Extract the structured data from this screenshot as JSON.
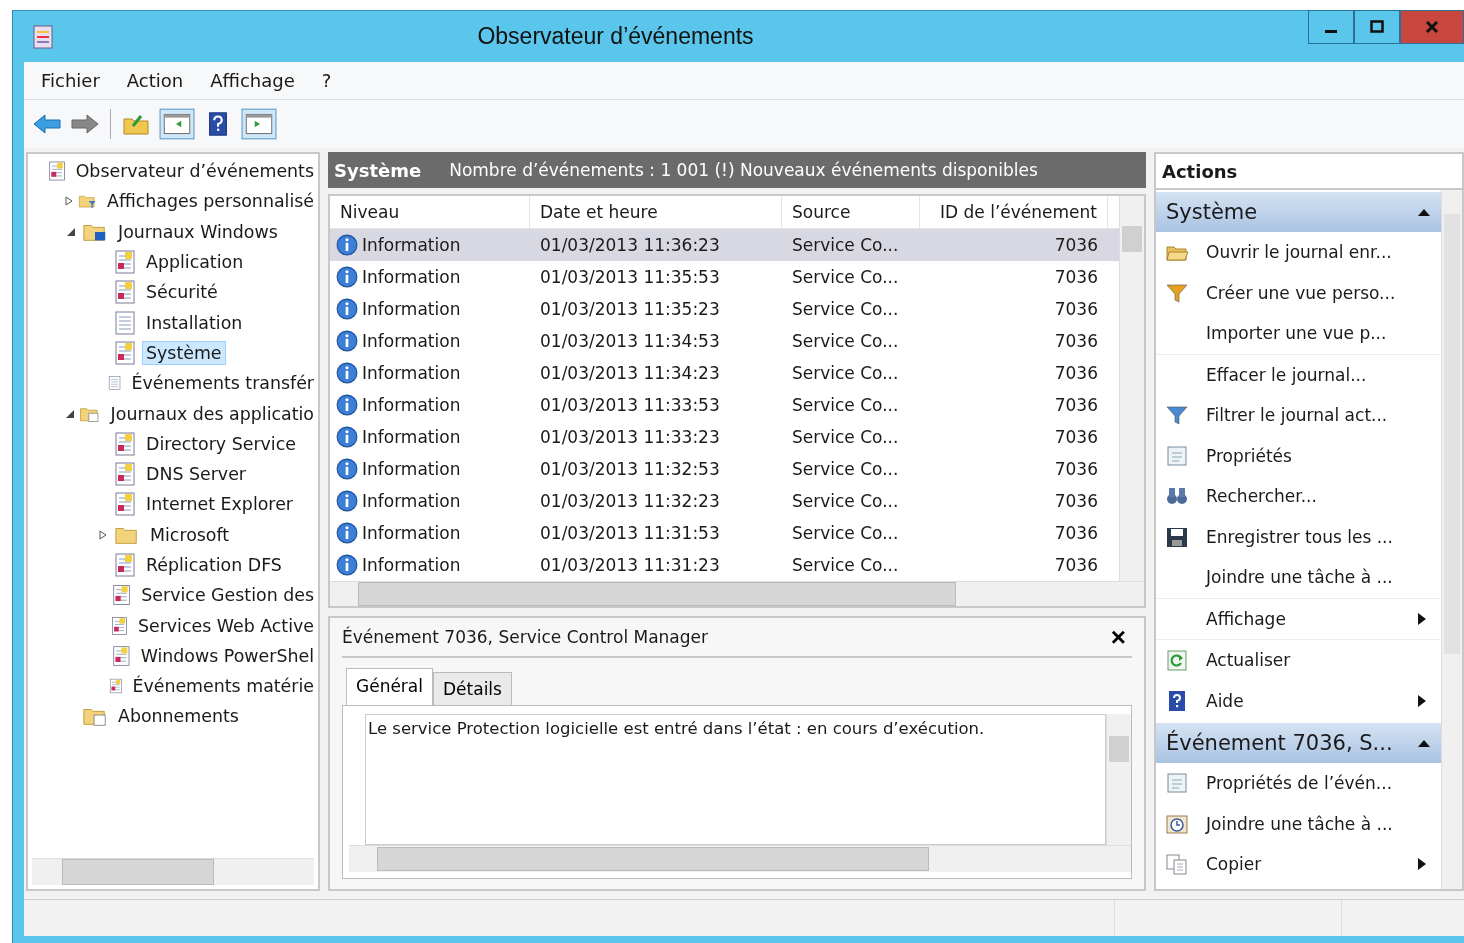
{
  "window": {
    "title": "Observateur d’événements"
  },
  "menu": [
    "Fichier",
    "Action",
    "Affichage",
    "?"
  ],
  "tree": [
    {
      "label": "Observateur d’événements",
      "kind": "root",
      "selected": false,
      "children": [
        {
          "label": "Affichages personnalisé",
          "kind": "custom",
          "expanded": false,
          "selected": false
        },
        {
          "label": "Journaux Windows",
          "kind": "windows",
          "expanded": true,
          "selected": false,
          "children": [
            {
              "label": "Application",
              "kind": "log",
              "selected": false
            },
            {
              "label": "Sécurité",
              "kind": "log",
              "selected": false
            },
            {
              "label": "Installation",
              "kind": "plain",
              "selected": false
            },
            {
              "label": "Système",
              "kind": "log",
              "selected": true
            },
            {
              "label": "Événements transfér",
              "kind": "plain",
              "selected": false
            }
          ]
        },
        {
          "label": "Journaux des applicatio",
          "kind": "apps",
          "expanded": true,
          "selected": false,
          "children": [
            {
              "label": "Directory Service",
              "kind": "log",
              "selected": false
            },
            {
              "label": "DNS Server",
              "kind": "log",
              "selected": false
            },
            {
              "label": "Internet Explorer",
              "kind": "log",
              "selected": false
            },
            {
              "label": "Microsoft",
              "kind": "folder",
              "expanded": false,
              "selected": false
            },
            {
              "label": "Réplication DFS",
              "kind": "log",
              "selected": false
            },
            {
              "label": "Service Gestion des",
              "kind": "log",
              "selected": false
            },
            {
              "label": "Services Web Active",
              "kind": "log",
              "selected": false
            },
            {
              "label": "Windows PowerShel",
              "kind": "log",
              "selected": false
            },
            {
              "label": "Événements matérie",
              "kind": "log",
              "selected": false
            }
          ]
        },
        {
          "label": "Abonnements",
          "kind": "subs",
          "selected": false
        }
      ]
    }
  ],
  "log_header": {
    "title": "Système",
    "info": "Nombre d’événements : 1 001 (!) Nouveaux événements disponibles"
  },
  "table": {
    "columns": [
      "Niveau",
      "Date et heure",
      "Source",
      "ID de l’événement"
    ],
    "rows": [
      {
        "level": "Information",
        "date": "01/03/2013 11:36:23",
        "source": "Service Co...",
        "id": "7036",
        "selected": true
      },
      {
        "level": "Information",
        "date": "01/03/2013 11:35:53",
        "source": "Service Co...",
        "id": "7036",
        "selected": false
      },
      {
        "level": "Information",
        "date": "01/03/2013 11:35:23",
        "source": "Service Co...",
        "id": "7036",
        "selected": false
      },
      {
        "level": "Information",
        "date": "01/03/2013 11:34:53",
        "source": "Service Co...",
        "id": "7036",
        "selected": false
      },
      {
        "level": "Information",
        "date": "01/03/2013 11:34:23",
        "source": "Service Co...",
        "id": "7036",
        "selected": false
      },
      {
        "level": "Information",
        "date": "01/03/2013 11:33:53",
        "source": "Service Co...",
        "id": "7036",
        "selected": false
      },
      {
        "level": "Information",
        "date": "01/03/2013 11:33:23",
        "source": "Service Co...",
        "id": "7036",
        "selected": false
      },
      {
        "level": "Information",
        "date": "01/03/2013 11:32:53",
        "source": "Service Co...",
        "id": "7036",
        "selected": false
      },
      {
        "level": "Information",
        "date": "01/03/2013 11:32:23",
        "source": "Service Co...",
        "id": "7036",
        "selected": false
      },
      {
        "level": "Information",
        "date": "01/03/2013 11:31:53",
        "source": "Service Co...",
        "id": "7036",
        "selected": false
      },
      {
        "level": "Information",
        "date": "01/03/2013 11:31:23",
        "source": "Service Co...",
        "id": "7036",
        "selected": false
      }
    ]
  },
  "detail": {
    "title": "Événement 7036, Service Control Manager",
    "close": "×",
    "tabs": [
      {
        "label": "Général",
        "selected": true
      },
      {
        "label": "Détails",
        "selected": false
      }
    ],
    "text": "Le service Protection logicielle est entré dans l’état : en cours d’exécution."
  },
  "actions": {
    "title": "Actions",
    "sections": [
      {
        "title": "Système",
        "items": [
          {
            "label": "Ouvrir le journal enr...",
            "kind": "open",
            "submenu": false,
            "divider": false
          },
          {
            "label": "Créer une vue perso...",
            "kind": "funnel-gold",
            "submenu": false,
            "divider": false
          },
          {
            "label": "Importer une vue p...",
            "kind": "none",
            "submenu": false,
            "divider": true
          },
          {
            "label": "Effacer le journal...",
            "kind": "none",
            "submenu": false,
            "divider": false
          },
          {
            "label": "Filtrer le journal act...",
            "kind": "funnel",
            "submenu": false,
            "divider": false
          },
          {
            "label": "Propriétés",
            "kind": "props",
            "submenu": false,
            "divider": false
          },
          {
            "label": "Rechercher...",
            "kind": "find",
            "submenu": false,
            "divider": false
          },
          {
            "label": "Enregistrer tous les ...",
            "kind": "save",
            "submenu": false,
            "divider": false
          },
          {
            "label": "Joindre une tâche à ...",
            "kind": "none",
            "submenu": false,
            "divider": true
          },
          {
            "label": "Affichage",
            "kind": "none",
            "submenu": true,
            "divider": true
          },
          {
            "label": "Actualiser",
            "kind": "refresh",
            "submenu": false,
            "divider": false
          },
          {
            "label": "Aide",
            "kind": "help",
            "submenu": true,
            "divider": false
          }
        ]
      },
      {
        "title": "Événement 7036, S...",
        "items": [
          {
            "label": "Propriétés de l’évén...",
            "kind": "props",
            "submenu": false,
            "divider": false
          },
          {
            "label": "Joindre une tâche à ...",
            "kind": "task",
            "submenu": false,
            "divider": false
          },
          {
            "label": "Copier",
            "kind": "copy",
            "submenu": true,
            "divider": false
          }
        ]
      }
    ]
  }
}
